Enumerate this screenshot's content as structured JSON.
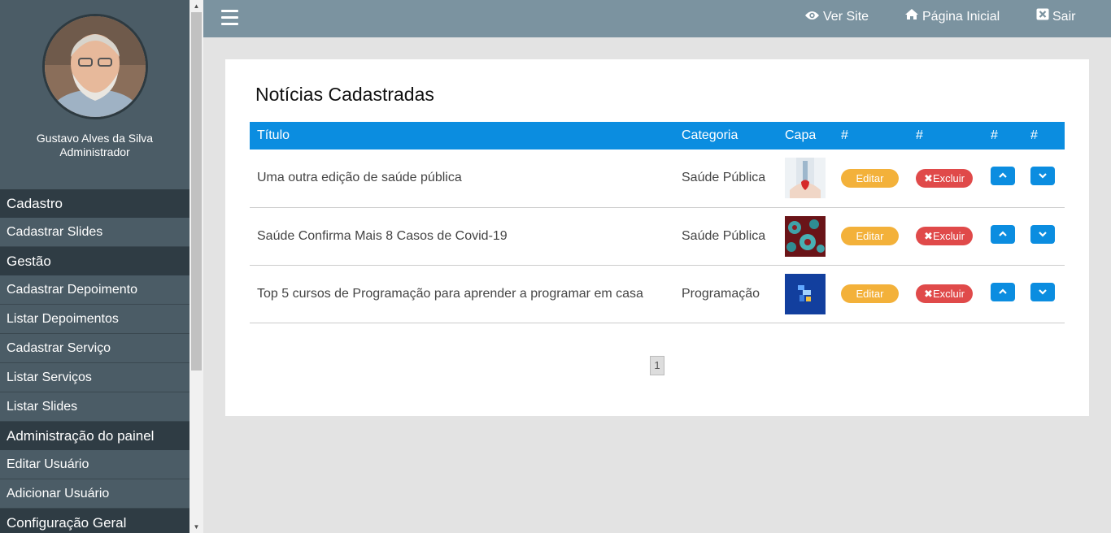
{
  "user": {
    "name": "Gustavo Alves da Silva",
    "role": "Administrador"
  },
  "menu": [
    {
      "type": "header",
      "label": "Cadastro",
      "name": "menu-header-cadastro"
    },
    {
      "type": "item",
      "label": "Cadastrar Slides",
      "name": "menu-item-cadastrar-slides"
    },
    {
      "type": "header",
      "label": "Gestão",
      "name": "menu-header-gestao"
    },
    {
      "type": "item",
      "label": "Cadastrar Depoimento",
      "name": "menu-item-cadastrar-depoimento"
    },
    {
      "type": "item",
      "label": "Listar Depoimentos",
      "name": "menu-item-listar-depoimentos"
    },
    {
      "type": "item",
      "label": "Cadastrar Serviço",
      "name": "menu-item-cadastrar-servico"
    },
    {
      "type": "item",
      "label": "Listar Serviços",
      "name": "menu-item-listar-servicos"
    },
    {
      "type": "item",
      "label": "Listar Slides",
      "name": "menu-item-listar-slides"
    },
    {
      "type": "header",
      "label": "Administração do painel",
      "name": "menu-header-administracao"
    },
    {
      "type": "item",
      "label": "Editar Usuário",
      "name": "menu-item-editar-usuario"
    },
    {
      "type": "item",
      "label": "Adicionar Usuário",
      "name": "menu-item-adicionar-usuario"
    },
    {
      "type": "header",
      "label": "Configuração Geral",
      "name": "menu-header-configuracao"
    }
  ],
  "topbar": {
    "ver_site": "Ver Site",
    "pagina_inicial": "Página Inicial",
    "sair": "Sair"
  },
  "content": {
    "title": "Notícias Cadastradas",
    "columns": [
      "Título",
      "Categoria",
      "Capa",
      "#",
      "#",
      "#",
      "#"
    ],
    "rows": [
      {
        "titulo": "Uma outra edição de saúde pública",
        "categoria": "Saúde Pública",
        "capa_icon": "health-heart-thumbnail"
      },
      {
        "titulo": "Saúde Confirma Mais 8 Casos de Covid-19",
        "categoria": "Saúde Pública",
        "capa_icon": "virus-thumbnail"
      },
      {
        "titulo": "Top 5 cursos de Programação para aprender a programar em casa",
        "categoria": "Programação",
        "capa_icon": "programming-thumbnail"
      }
    ],
    "edit_label": "Editar",
    "delete_label": "Excluir",
    "page": "1"
  },
  "colors": {
    "sidebar": "#4b5c66",
    "sidebar_header": "#2f3c44",
    "topbar": "#7b93a0",
    "table_header": "#0b8de0",
    "edit": "#f3b13a",
    "delete": "#e04a4a"
  }
}
